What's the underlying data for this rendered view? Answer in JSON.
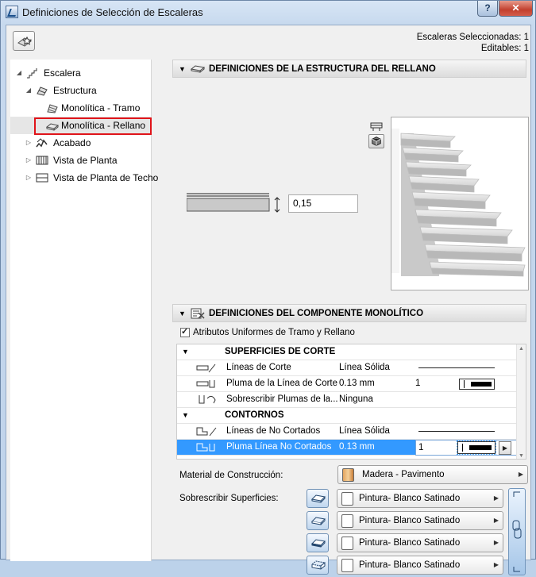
{
  "window": {
    "title": "Definiciones de Selección de Escaleras",
    "help_label": "?",
    "close_label": "✕"
  },
  "selection_info": {
    "line1": "Escaleras Seleccionadas: 1",
    "line2": "Editables: 1"
  },
  "tree": {
    "items": [
      {
        "label": "Escalera",
        "icon": "stair-icon",
        "expander": "◢"
      },
      {
        "label": "Estructura",
        "icon": "structure-icon",
        "expander": "◢"
      },
      {
        "label": "Monolítica - Tramo",
        "icon": "monolithic-run-icon",
        "expander": ""
      },
      {
        "label": "Monolítica - Rellano",
        "icon": "monolithic-landing-icon",
        "expander": ""
      },
      {
        "label": "Acabado",
        "icon": "finish-icon",
        "expander": "▷"
      },
      {
        "label": "Vista de Planta",
        "icon": "floor-plan-icon",
        "expander": "▷"
      },
      {
        "label": "Vista de Planta de Techo",
        "icon": "ceiling-plan-icon",
        "expander": "▷"
      }
    ]
  },
  "landing_section": {
    "title": "DEFINICIONES DE LA ESTRUCTURA DEL RELLANO",
    "thickness_value": "0,15"
  },
  "component_section": {
    "title": "DEFINICIONES DEL COMPONENTE MONOLÍTICO",
    "uniform_checkbox_label": "Atributos Uniformes de Tramo y Rellano",
    "uniform_checked": true,
    "grid": {
      "groups": [
        {
          "title": "SUPERFICIES DE CORTE",
          "rows": [
            {
              "label": "Líneas de Corte",
              "value": "Línea Sólida",
              "number": ""
            },
            {
              "label": "Pluma de la Línea de Corte",
              "value": "0.13 mm",
              "number": "1"
            },
            {
              "label": "Sobrescribir Plumas de la...",
              "value": "Ninguna",
              "number": ""
            }
          ]
        },
        {
          "title": "CONTORNOS",
          "rows": [
            {
              "label": "Líneas de No Cortados",
              "value": "Línea Sólida",
              "number": ""
            },
            {
              "label": "Pluma Línea No Cortados",
              "value": "0.13 mm",
              "number": "1"
            }
          ]
        }
      ]
    },
    "material_label": "Material de Construcción:",
    "material_value": "Madera - Pavimento",
    "override_label": "Sobrescribir Superficies:",
    "surfaces": [
      "Pintura- Blanco Satinado",
      "Pintura- Blanco Satinado",
      "Pintura- Blanco Satinado",
      "Pintura- Blanco Satinado"
    ]
  },
  "colors": {
    "highlight": "#3399ff",
    "selection_box": "#e0141a"
  }
}
